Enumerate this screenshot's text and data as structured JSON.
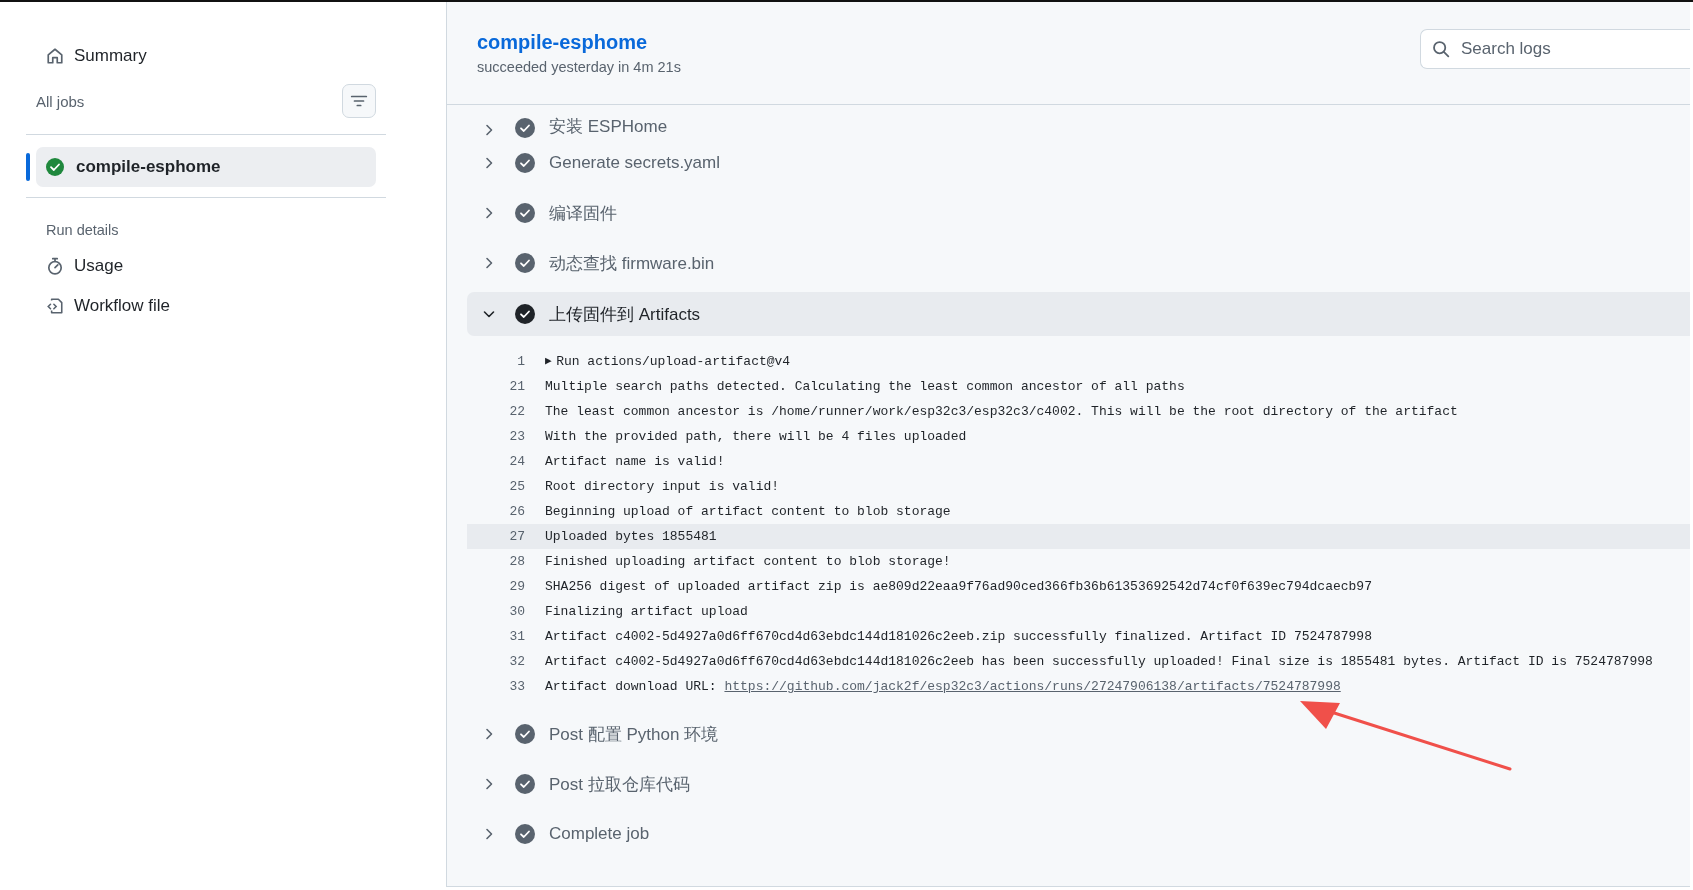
{
  "sidebar": {
    "summary": "Summary",
    "jobs_heading": "All jobs",
    "jobs": [
      {
        "name": "compile-esphome",
        "selected": true
      }
    ],
    "run_details_heading": "Run details",
    "links": [
      {
        "label": "Usage",
        "kind": "usage"
      },
      {
        "label": "Workflow file",
        "kind": "workflow"
      }
    ]
  },
  "job_header": {
    "title": "compile-esphome",
    "subtitle": "succeeded yesterday in 4m 21s"
  },
  "search": {
    "placeholder": "Search logs"
  },
  "steps": [
    {
      "title": "安装 ESPHome",
      "expanded": false
    },
    {
      "title": "Generate secrets.yaml",
      "expanded": false
    },
    {
      "title": "编译固件",
      "expanded": false
    },
    {
      "title": "动态查找 firmware.bin",
      "expanded": false
    },
    {
      "title": "上传固件到 Artifacts",
      "expanded": true,
      "log": [
        {
          "number": "1",
          "marker": "▶",
          "text": "Run actions/upload-artifact@v4",
          "highlighted": false
        },
        {
          "number": "21",
          "text": "Multiple search paths detected. Calculating the least common ancestor of all paths",
          "highlighted": false
        },
        {
          "number": "22",
          "text": "The least common ancestor is /home/runner/work/esp32c3/esp32c3/c4002. This will be the root directory of the artifact",
          "highlighted": false
        },
        {
          "number": "23",
          "text": "With the provided path, there will be 4 files uploaded",
          "highlighted": false
        },
        {
          "number": "24",
          "text": "Artifact name is valid!",
          "highlighted": false
        },
        {
          "number": "25",
          "text": "Root directory input is valid!",
          "highlighted": false
        },
        {
          "number": "26",
          "text": "Beginning upload of artifact content to blob storage",
          "highlighted": false
        },
        {
          "number": "27",
          "text": "Uploaded bytes 1855481",
          "highlighted": true
        },
        {
          "number": "28",
          "text": "Finished uploading artifact content to blob storage!",
          "highlighted": false
        },
        {
          "number": "29",
          "text": "SHA256 digest of uploaded artifact zip is ae809d22eaa9f76ad90ced366fb36b61353692542d74cf0f639ec794dcaecb97",
          "highlighted": false
        },
        {
          "number": "30",
          "text": "Finalizing artifact upload",
          "highlighted": false
        },
        {
          "number": "31",
          "text": "Artifact c4002-5d4927a0d6ff670cd4d63ebdc144d181026c2eeb.zip successfully finalized. Artifact ID 7524787998",
          "highlighted": false
        },
        {
          "number": "32",
          "text": "Artifact c4002-5d4927a0d6ff670cd4d63ebdc144d181026c2eeb has been successfully uploaded! Final size is 1855481 bytes. Artifact ID is 7524787998",
          "highlighted": false
        },
        {
          "number": "33",
          "text": "Artifact download URL:",
          "link": "https://github.com/jack2f/esp32c3/actions/runs/27247906138/artifacts/7524787998",
          "highlighted": false
        }
      ]
    },
    {
      "title": "Post 配置 Python 环境",
      "expanded": false
    },
    {
      "title": "Post 拉取仓库代码",
      "expanded": false
    },
    {
      "title": "Complete job",
      "expanded": false
    }
  ]
}
